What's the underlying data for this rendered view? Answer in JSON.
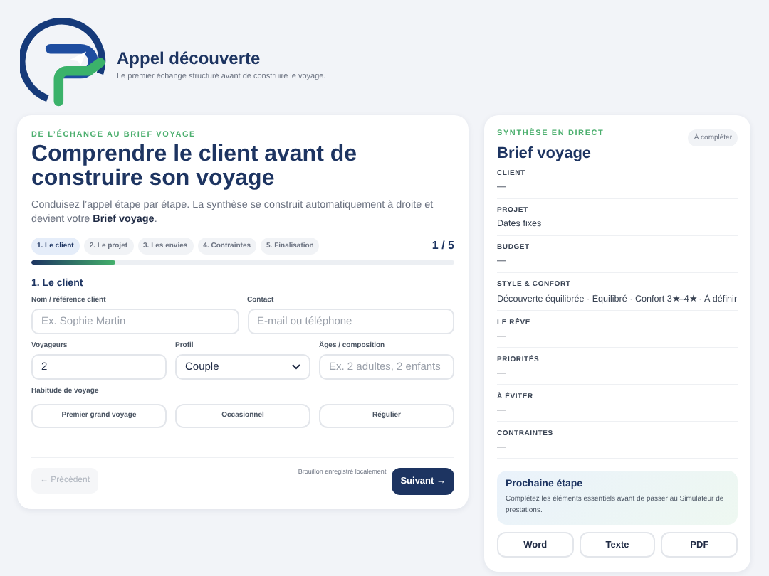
{
  "header": {
    "title": "Appel découverte",
    "subtitle": "Le premier échange structuré avant de construire le voyage."
  },
  "form": {
    "eyebrow": "DE L’ÉCHANGE AU BRIEF VOYAGE",
    "title": "Comprendre le client avant de construire son voyage",
    "intro": "Conduisez l’appel étape par étape. La synthèse se construit automatiquement à droite et devient votre **Brief voyage**.",
    "steps": [
      {
        "label": "1. Le client",
        "selected": true
      },
      {
        "label": "2. Le projet",
        "selected": false
      },
      {
        "label": "3. Les envies",
        "selected": false
      },
      {
        "label": "4. Contraintes",
        "selected": false
      },
      {
        "label": "5. Finalisation",
        "selected": false
      }
    ],
    "step_count": "1 / 5",
    "progress": {
      "level": 0.2
    },
    "section_title": "1. Le client",
    "rows": [
      [
        {
          "kind": "input",
          "label": "Nom / référence client",
          "placeholder": "Ex. Sophie Martin"
        },
        {
          "kind": "input",
          "label": "Contact",
          "placeholder": "E-mail ou téléphone"
        }
      ],
      [
        {
          "kind": "input",
          "label": "Voyageurs",
          "value": "2"
        },
        {
          "kind": "select",
          "label": "Profil",
          "value": "Couple"
        },
        {
          "kind": "input",
          "label": "Âges / composition",
          "placeholder": "Ex. 2 adultes, 2 enfants"
        }
      ]
    ],
    "habit": {
      "label": "Habitude de voyage",
      "options": [
        {
          "label": "Premier grand voyage",
          "selected": false
        },
        {
          "label": "Occasionnel",
          "selected": false
        },
        {
          "label": "Régulier",
          "selected": false
        }
      ]
    },
    "prev_button": {
      "label": "← Précédent",
      "disabled": true
    },
    "draft_note": "Brouillon enregistré localement",
    "next_button": {
      "label": "Suivant →",
      "disabled": false
    }
  },
  "brief": {
    "eyebrow": "SYNTHÈSE EN DIRECT",
    "badge": "À compléter",
    "title": "Brief voyage",
    "sections": [
      {
        "label": "CLIENT",
        "value": "—"
      },
      {
        "label": "PROJET",
        "value": "Dates fixes"
      },
      {
        "label": "BUDGET",
        "value": "—"
      },
      {
        "label": "STYLE & CONFORT",
        "value": "Découverte équilibrée · Équilibré · Confort 3★–4★ · À définir"
      },
      {
        "label": "LE RÊVE",
        "value": "—"
      },
      {
        "label": "PRIORITÉS",
        "value": "—"
      },
      {
        "label": "À ÉVITER",
        "value": "—"
      },
      {
        "label": "CONTRAINTES",
        "value": "—"
      }
    ],
    "next_step": {
      "title": "Prochaine étape",
      "text": "Complétez les éléments essentiels avant de passer au Simulateur de prestations."
    },
    "exports": [
      "Word",
      "Texte",
      "PDF"
    ]
  }
}
